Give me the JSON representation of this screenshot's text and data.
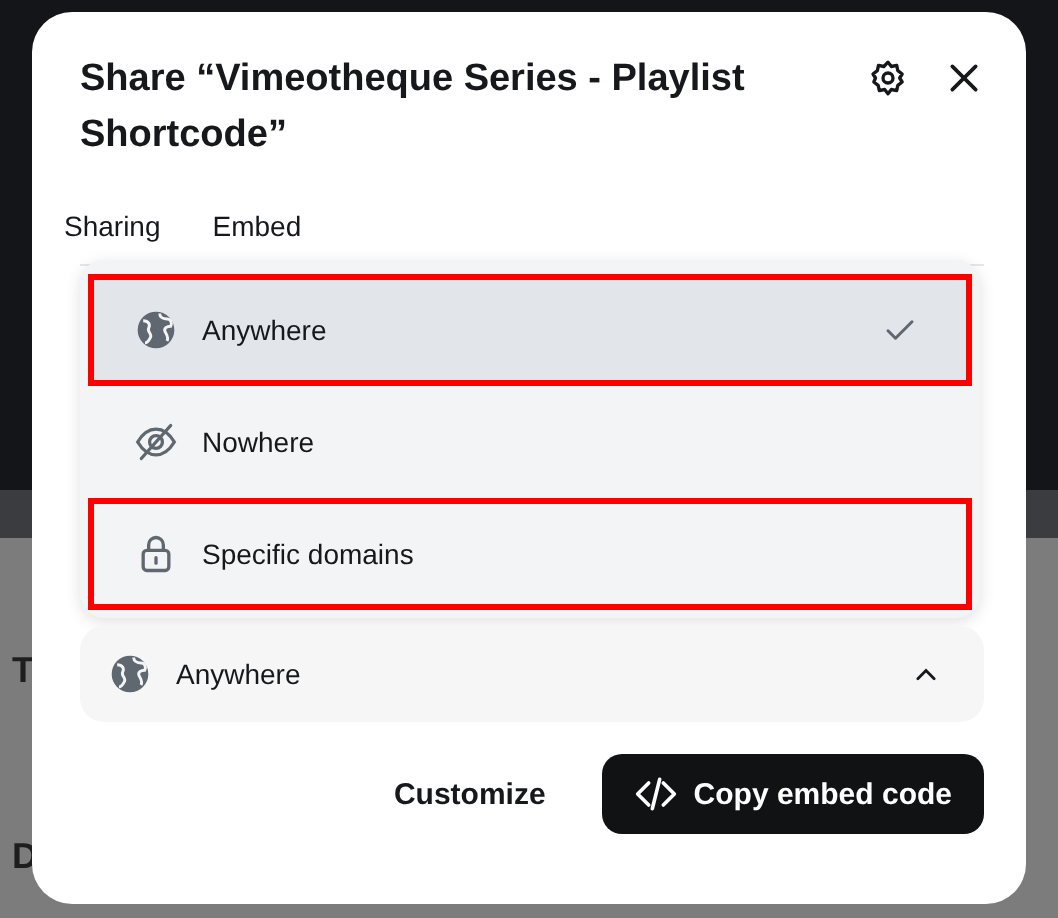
{
  "backdrop": {
    "labels": [
      "T",
      "D"
    ]
  },
  "dialog": {
    "title": "Share “Vimeotheque Series - Playlist Shortcode”"
  },
  "tabs": [
    {
      "label": "Sharing"
    },
    {
      "label": "Embed"
    }
  ],
  "menu": [
    {
      "label": "Anywhere",
      "selected": true,
      "highlighted": true
    },
    {
      "label": "Nowhere",
      "selected": false,
      "highlighted": false
    },
    {
      "label": "Specific domains",
      "selected": false,
      "highlighted": true
    }
  ],
  "select": {
    "value": "Anywhere",
    "expanded": true
  },
  "buttons": [
    {
      "label": "Customize",
      "kind": "plain"
    },
    {
      "label": "Copy embed code",
      "kind": "primary"
    }
  ]
}
